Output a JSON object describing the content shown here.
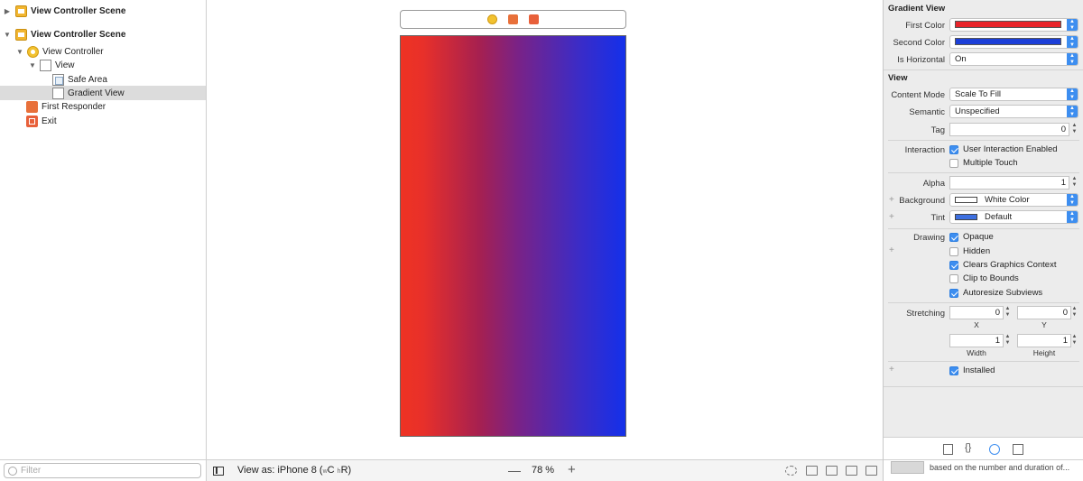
{
  "outline": {
    "items": [
      {
        "label": "View Controller Scene",
        "collapsed": true
      },
      {
        "label": "View Controller Scene",
        "collapsed": false
      },
      {
        "label": "View Controller"
      },
      {
        "label": "View"
      },
      {
        "label": "Safe Area"
      },
      {
        "label": "Gradient View",
        "selected": true
      },
      {
        "label": "First Responder"
      },
      {
        "label": "Exit"
      }
    ],
    "filter_placeholder": "Filter"
  },
  "canvas": {
    "gradient_colors": [
      "#ee3323",
      "#1430ea"
    ]
  },
  "bottom_bar": {
    "view_as_label": "View as: iPhone 8",
    "size_class_w": "w",
    "size_class_w_val": "C",
    "size_class_h": "h",
    "size_class_h_val": "R",
    "zoom_minus": "—",
    "zoom": "78 %",
    "zoom_plus": "+"
  },
  "inspector": {
    "gradient_section": {
      "title": "Gradient View",
      "first_color_label": "First Color",
      "first_color": "#e8242a",
      "second_color_label": "Second Color",
      "second_color": "#1c3fd8",
      "is_horizontal_label": "Is Horizontal",
      "is_horizontal_value": "On"
    },
    "view_section": {
      "title": "View",
      "content_mode_label": "Content Mode",
      "content_mode_value": "Scale To Fill",
      "semantic_label": "Semantic",
      "semantic_value": "Unspecified",
      "tag_label": "Tag",
      "tag_value": "0",
      "interaction_label": "Interaction",
      "user_interaction_label": "User Interaction Enabled",
      "multiple_touch_label": "Multiple Touch",
      "alpha_label": "Alpha",
      "alpha_value": "1",
      "background_label": "Background",
      "background_value": "White Color",
      "tint_label": "Tint",
      "tint_value": "Default",
      "tint_color": "#3d6fe0",
      "drawing_label": "Drawing",
      "opaque_label": "Opaque",
      "hidden_label": "Hidden",
      "clears_label": "Clears Graphics Context",
      "clip_label": "Clip to Bounds",
      "autoresize_label": "Autoresize Subviews",
      "stretching_label": "Stretching",
      "stretch_x_value": "0",
      "stretch_y_value": "0",
      "x_label": "X",
      "y_label": "Y",
      "stretch_w_value": "1",
      "stretch_h_value": "1",
      "width_label": "Width",
      "height_label": "Height",
      "installed_label": "Installed"
    },
    "library": {
      "description": "based on the number and duration of..."
    }
  }
}
